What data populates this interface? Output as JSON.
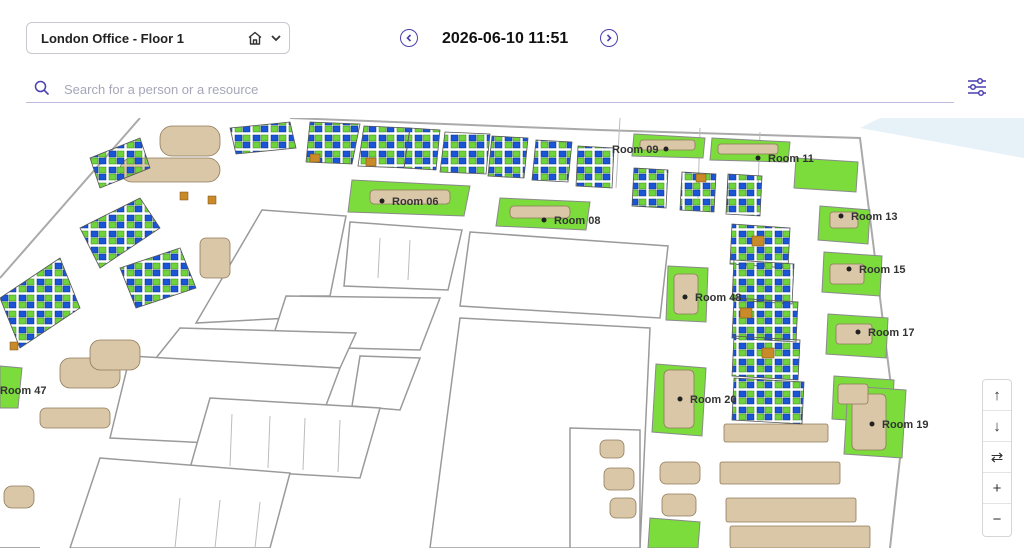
{
  "header": {
    "floor_selector": "London Office - Floor 1",
    "datetime": "2026-06-10 11:51"
  },
  "search": {
    "placeholder": "Search for a person or a resource",
    "value": ""
  },
  "icons": {
    "home": "home-icon",
    "dropdown": "chevron-down-icon",
    "prev": "chevron-left-icon",
    "next": "chevron-right-icon",
    "search": "search-icon",
    "filters": "sliders-icon"
  },
  "rooms": {
    "r06": "Room 06",
    "r08": "Room 08",
    "r09": "Room 09",
    "r11": "Room 11",
    "r13": "Room 13",
    "r15": "Room 15",
    "r17": "Room 17",
    "r19": "Room 19",
    "r20": "Room 20",
    "r47": "Room 47",
    "r48": "Room 48"
  },
  "zoom_controls": {
    "up": "↑",
    "down": "↓",
    "swap": "⇄",
    "zoom_in": "+",
    "zoom_out": "−"
  },
  "colors": {
    "accent": "#4a3fb0",
    "desk_available": "#6fd33a",
    "desk_booked": "#1a55d6",
    "desk_occupied": "#c98a2a",
    "furniture": "#d9c7a8",
    "room_floor": "#7bdc3c"
  }
}
